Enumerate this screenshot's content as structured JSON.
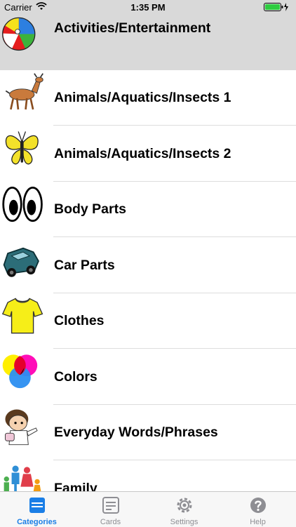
{
  "status_bar": {
    "carrier": "Carrier",
    "time": "1:35 PM"
  },
  "categories": [
    {
      "label": "Activities/Entertainment",
      "icon": "beach-ball-icon",
      "selected": true
    },
    {
      "label": "Animals/Aquatics/Insects 1",
      "icon": "deer-icon"
    },
    {
      "label": "Animals/Aquatics/Insects 2",
      "icon": "butterfly-icon"
    },
    {
      "label": "Body Parts",
      "icon": "eyes-icon"
    },
    {
      "label": "Car Parts",
      "icon": "car-icon"
    },
    {
      "label": "Clothes",
      "icon": "tshirt-icon"
    },
    {
      "label": "Colors",
      "icon": "color-circles-icon"
    },
    {
      "label": "Everyday Words/Phrases",
      "icon": "boy-icon"
    },
    {
      "label": "Family",
      "icon": "family-icon"
    }
  ],
  "tabs": [
    {
      "label": "Categories",
      "icon": "categories-icon",
      "active": true
    },
    {
      "label": "Cards",
      "icon": "cards-icon"
    },
    {
      "label": "Settings",
      "icon": "settings-gear-icon"
    },
    {
      "label": "Help",
      "icon": "help-icon"
    }
  ],
  "colors": {
    "accent": "#1a7ee6",
    "selected_row": "#d9d9d9",
    "tab_inactive": "#8e8e93"
  }
}
